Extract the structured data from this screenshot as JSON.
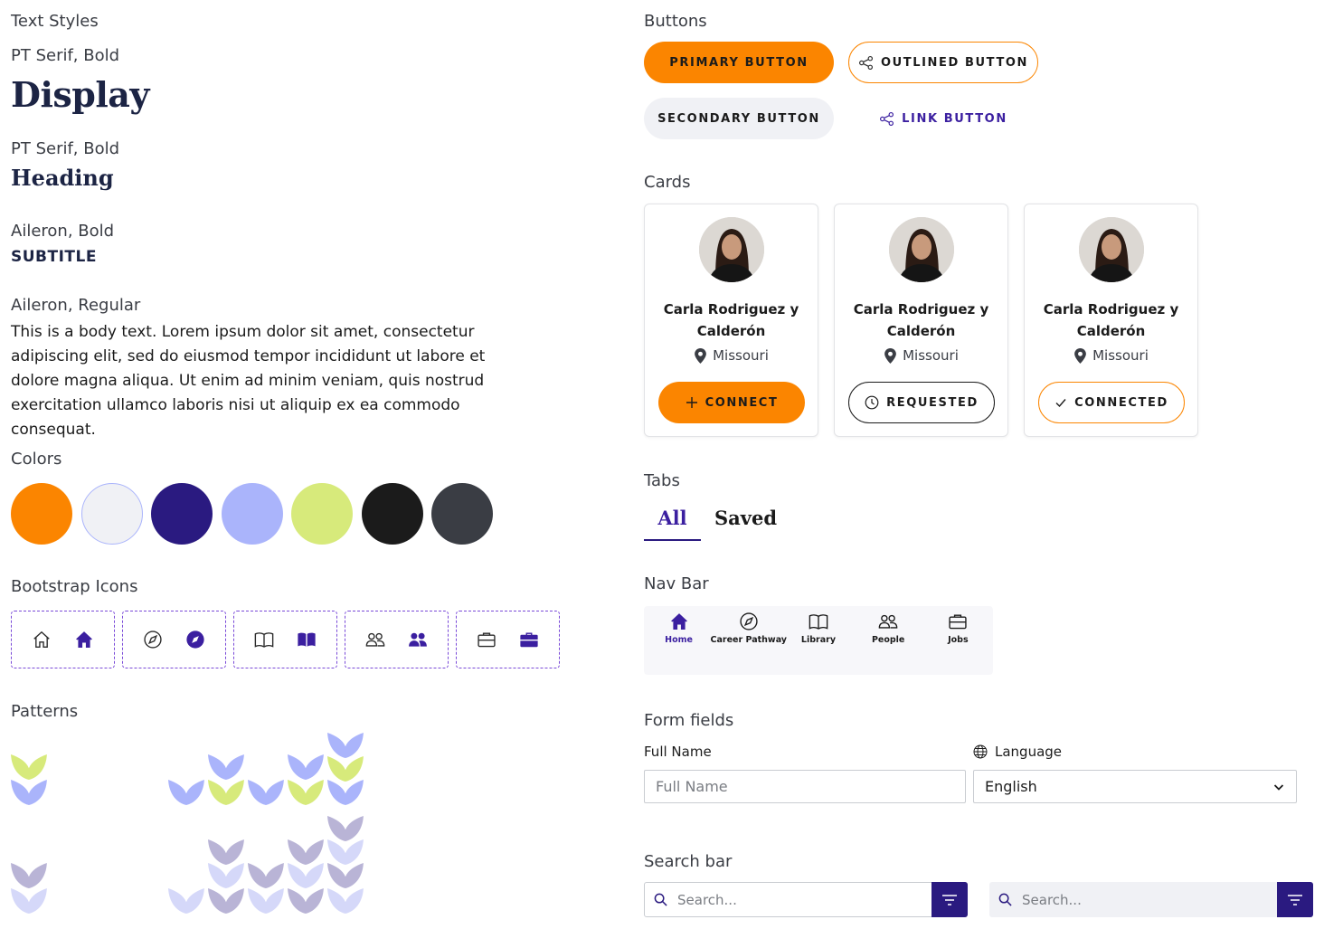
{
  "text_styles": {
    "title": "Text Styles",
    "display_font": "PT Serif, Bold",
    "display_sample": "Display",
    "heading_font": "PT Serif, Bold",
    "heading_sample": "Heading",
    "subtitle_font": "Aileron, Bold",
    "subtitle_sample": "SUBTITLE",
    "body_font": "Aileron, Regular",
    "body_sample": "This is a body text. Lorem ipsum dolor sit amet, consectetur adipiscing elit, sed do eiusmod tempor incididunt ut labore et dolore magna aliqua. Ut enim ad minim veniam, quis nostrud exercitation ullamco laboris nisi ut aliquip ex ea commodo consequat."
  },
  "colors": {
    "title": "Colors",
    "swatches": [
      "#fb8500",
      "#f0f1f5",
      "#2a1a80",
      "#aab4fb",
      "#d7ea7b",
      "#1b1b1b",
      "#3a3d44"
    ]
  },
  "icons": {
    "title": "Bootstrap Icons",
    "groups": [
      [
        "house-icon",
        "house-fill-icon"
      ],
      [
        "compass-icon",
        "compass-fill-icon"
      ],
      [
        "book-icon",
        "book-fill-icon"
      ],
      [
        "people-icon",
        "people-fill-icon"
      ],
      [
        "briefcase-icon",
        "briefcase-fill-icon"
      ]
    ]
  },
  "patterns": {
    "title": "Patterns"
  },
  "buttons": {
    "title": "Buttons",
    "primary": "PRIMARY BUTTON",
    "outlined": "OUTLINED BUTTON",
    "secondary": "SECONDARY BUTTON",
    "link": "LINK BUTTON"
  },
  "cards": {
    "title": "Cards",
    "items": [
      {
        "name": "Carla Rodriguez y Calderón",
        "location": "Missouri",
        "action": "CONNECT"
      },
      {
        "name": "Carla Rodriguez y Calderón",
        "location": "Missouri",
        "action": "REQUESTED"
      },
      {
        "name": "Carla Rodriguez y Calderón",
        "location": "Missouri",
        "action": "CONNECTED"
      }
    ]
  },
  "tabs": {
    "title": "Tabs",
    "items": [
      "All",
      "Saved"
    ],
    "active": "All"
  },
  "navbar": {
    "title": "Nav Bar",
    "items": [
      "Home",
      "Career Pathway",
      "Library",
      "People",
      "Jobs"
    ],
    "active": "Home"
  },
  "form": {
    "title": "Form fields",
    "full_name_label": "Full Name",
    "full_name_placeholder": "Full Name",
    "language_label": "Language",
    "language_value": "English"
  },
  "search": {
    "title": "Search bar",
    "placeholder": "Search..."
  },
  "theme": {
    "orange": "#fb8500",
    "navy": "#2a1a80",
    "indigo": "#5b2fc9",
    "lavender": "#aab4fb",
    "lime": "#d7ea7b"
  }
}
